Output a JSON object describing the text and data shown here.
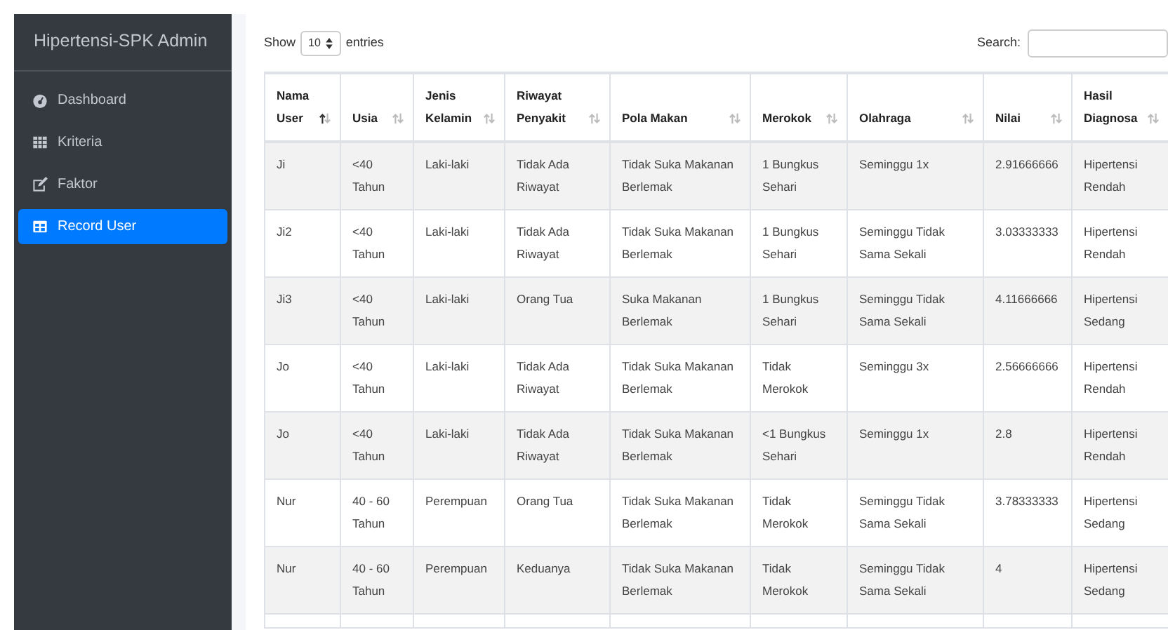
{
  "sidebar": {
    "title": "Hipertensi-SPK Admin",
    "items": [
      {
        "label": "Dashboard",
        "selected": false
      },
      {
        "label": "Kriteria",
        "selected": false
      },
      {
        "label": "Faktor",
        "selected": false
      },
      {
        "label": "Record User",
        "selected": true
      }
    ]
  },
  "length_menu": {
    "before": "Show",
    "value": "10",
    "after": "entries"
  },
  "search": {
    "label": "Search:"
  },
  "table": {
    "columns": [
      {
        "label": "Nama User",
        "sorted_ascending": true
      },
      {
        "label": "Usia",
        "sorted_ascending": false
      },
      {
        "label": "Jenis Kelamin",
        "sorted_ascending": false
      },
      {
        "label": "Riwayat Penyakit",
        "sorted_ascending": false
      },
      {
        "label": "Pola Makan",
        "sorted_ascending": false
      },
      {
        "label": "Merokok",
        "sorted_ascending": false
      },
      {
        "label": "Olahraga",
        "sorted_ascending": false
      },
      {
        "label": "Nilai",
        "sorted_ascending": false
      },
      {
        "label": "Hasil Diagnosa",
        "sorted_ascending": false
      }
    ],
    "rows": [
      [
        "Ji",
        "<40 Tahun",
        "Laki-laki",
        "Tidak Ada Riwayat",
        "Tidak Suka Makanan Berlemak",
        "1 Bungkus Sehari",
        "Seminggu 1x",
        "2.91666666",
        "Hipertensi Rendah"
      ],
      [
        "Ji2",
        "<40 Tahun",
        "Laki-laki",
        "Tidak Ada Riwayat",
        "Tidak Suka Makanan Berlemak",
        "1 Bungkus Sehari",
        "Seminggu Tidak Sama Sekali",
        "3.03333333",
        "Hipertensi Rendah"
      ],
      [
        "Ji3",
        "<40 Tahun",
        "Laki-laki",
        "Orang Tua",
        "Suka Makanan Berlemak",
        "1 Bungkus Sehari",
        "Seminggu Tidak Sama Sekali",
        "4.11666666",
        "Hipertensi Sedang"
      ],
      [
        "Jo",
        "<40 Tahun",
        "Laki-laki",
        "Tidak Ada Riwayat",
        "Tidak Suka Makanan Berlemak",
        "Tidak Merokok",
        "Seminggu 3x",
        "2.56666666",
        "Hipertensi Rendah"
      ],
      [
        "Jo",
        "<40 Tahun",
        "Laki-laki",
        "Tidak Ada Riwayat",
        "Tidak Suka Makanan Berlemak",
        "<1 Bungkus Sehari",
        "Seminggu 1x",
        "2.8",
        "Hipertensi Rendah"
      ],
      [
        "Nur",
        "40 - 60 Tahun",
        "Perempuan",
        "Orang Tua",
        "Tidak Suka Makanan Berlemak",
        "Tidak Merokok",
        "Seminggu Tidak Sama Sekali",
        "3.78333333",
        "Hipertensi Sedang"
      ],
      [
        "Nur",
        "40 - 60 Tahun",
        "Perempuan",
        "Keduanya",
        "Tidak Suka Makanan Berlemak",
        "Tidak Merokok",
        "Seminggu Tidak Sama Sekali",
        "4",
        "Hipertensi Sedang"
      ]
    ]
  }
}
